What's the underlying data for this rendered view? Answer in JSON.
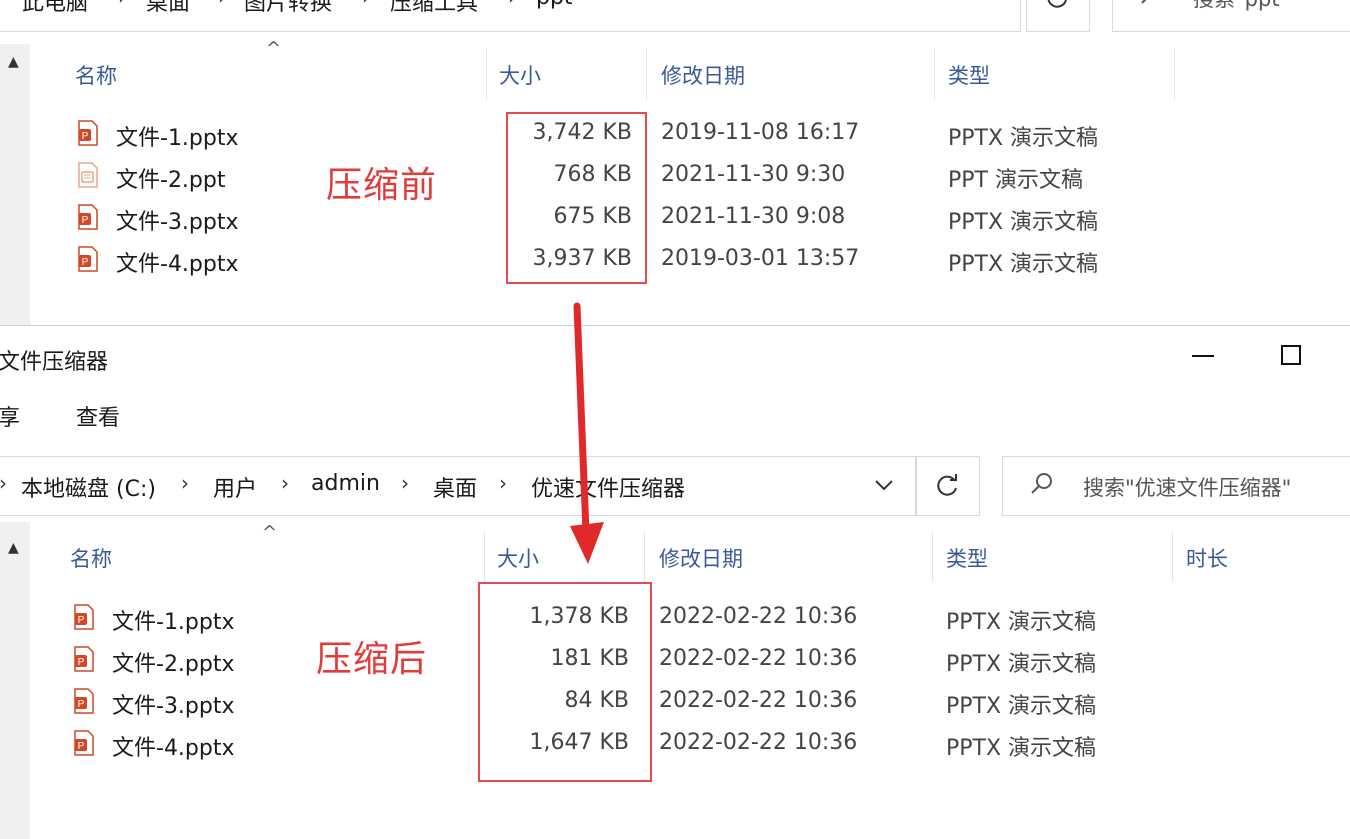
{
  "top_window": {
    "breadcrumbs": [
      "此电脑",
      "桌面",
      "图片转换",
      "压缩工具",
      "ppt"
    ],
    "search_placeholder": "搜索\"ppt\"",
    "columns": {
      "name": "名称",
      "size": "大小",
      "date": "修改日期",
      "type": "类型"
    },
    "files": [
      {
        "name": "文件-1.pptx",
        "size": "3,742 KB",
        "date": "2019-11-08 16:17",
        "type": "PPTX 演示文稿",
        "icon": "pptx-file-icon"
      },
      {
        "name": "文件-2.ppt",
        "size": "768 KB",
        "date": "2021-11-30 9:30",
        "type": "PPT 演示文稿",
        "icon": "ppt-file-icon"
      },
      {
        "name": "文件-3.pptx",
        "size": "675 KB",
        "date": "2021-11-30 9:08",
        "type": "PPTX 演示文稿",
        "icon": "pptx-file-icon"
      },
      {
        "name": "文件-4.pptx",
        "size": "3,937 KB",
        "date": "2019-03-01 13:57",
        "type": "PPTX 演示文稿",
        "icon": "pptx-file-icon"
      }
    ],
    "annotation": "压缩前"
  },
  "bottom_window": {
    "title": "文件压缩器",
    "menu": [
      "享",
      "查看"
    ],
    "breadcrumbs": [
      "本地磁盘 (C:)",
      "用户",
      "admin",
      "桌面",
      "优速文件压缩器"
    ],
    "search_placeholder": "搜索\"优速文件压缩器\"",
    "columns": {
      "name": "名称",
      "size": "大小",
      "date": "修改日期",
      "type": "类型",
      "duration": "时长"
    },
    "files": [
      {
        "name": "文件-1.pptx",
        "size": "1,378 KB",
        "date": "2022-02-22 10:36",
        "type": "PPTX 演示文稿",
        "icon": "pptx-file-icon"
      },
      {
        "name": "文件-2.pptx",
        "size": "181 KB",
        "date": "2022-02-22 10:36",
        "type": "PPTX 演示文稿",
        "icon": "pptx-file-icon"
      },
      {
        "name": "文件-3.pptx",
        "size": "84 KB",
        "date": "2022-02-22 10:36",
        "type": "PPTX 演示文稿",
        "icon": "pptx-file-icon"
      },
      {
        "name": "文件-4.pptx",
        "size": "1,647 KB",
        "date": "2022-02-22 10:36",
        "type": "PPTX 演示文稿",
        "icon": "pptx-file-icon"
      }
    ],
    "annotation": "压缩后"
  },
  "icons": {
    "refresh": "refresh-icon",
    "dropdown": "chevron-down-icon",
    "search": "search-icon",
    "minimize": "minimize-icon",
    "maximize": "maximize-icon",
    "sort": "sort-up-icon",
    "arrow": "red-down-arrow-icon"
  },
  "colors": {
    "highlight_box": "#e04b4b",
    "annotation_text": "#e23b3b",
    "column_header": "#3b5998",
    "pptx_icon": "#d24726"
  }
}
